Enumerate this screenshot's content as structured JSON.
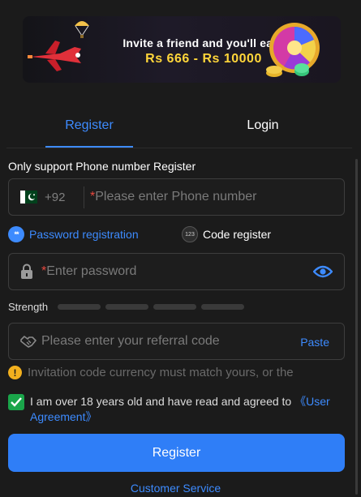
{
  "banner": {
    "line1": "Invite a friend and you'll earn",
    "line2": "Rs 666 - Rs 10000"
  },
  "tabs": [
    {
      "label": "Register",
      "active": true
    },
    {
      "label": "Login",
      "active": false
    }
  ],
  "form": {
    "section_label": "Only support Phone number Register",
    "phone": {
      "country_icon": "pakistan-flag-icon",
      "dial_code": "+92",
      "required_mark": "*",
      "placeholder": "Please enter Phone number"
    },
    "modes": [
      {
        "label": "Password registration",
        "badge": "**",
        "selected": true
      },
      {
        "label": "Code register",
        "badge": "123",
        "selected": false
      }
    ],
    "password": {
      "required_mark": "*",
      "placeholder": "Enter password",
      "icon": "lock-icon",
      "toggle_icon": "eye-icon"
    },
    "strength": {
      "label": "Strength",
      "segments": 4,
      "filled": 0
    },
    "referral": {
      "placeholder": "Please enter your referral code",
      "icon": "handshake-icon",
      "paste_label": "Paste"
    },
    "notice": "Invitation code currency must match yours, or the",
    "agreement": {
      "checked": true,
      "text": "I am over 18 years old and have read and agreed to ",
      "link": "《User Agreement》"
    },
    "submit_label": "Register",
    "customer_service": "Customer Service"
  },
  "colors": {
    "accent": "#3d8bff",
    "button": "#2f7ef7",
    "background": "#1b1b1b",
    "required": "#e8483f",
    "check": "#1aa54a",
    "warning": "#f2b01e",
    "banner_highlight": "#ffd63a"
  }
}
